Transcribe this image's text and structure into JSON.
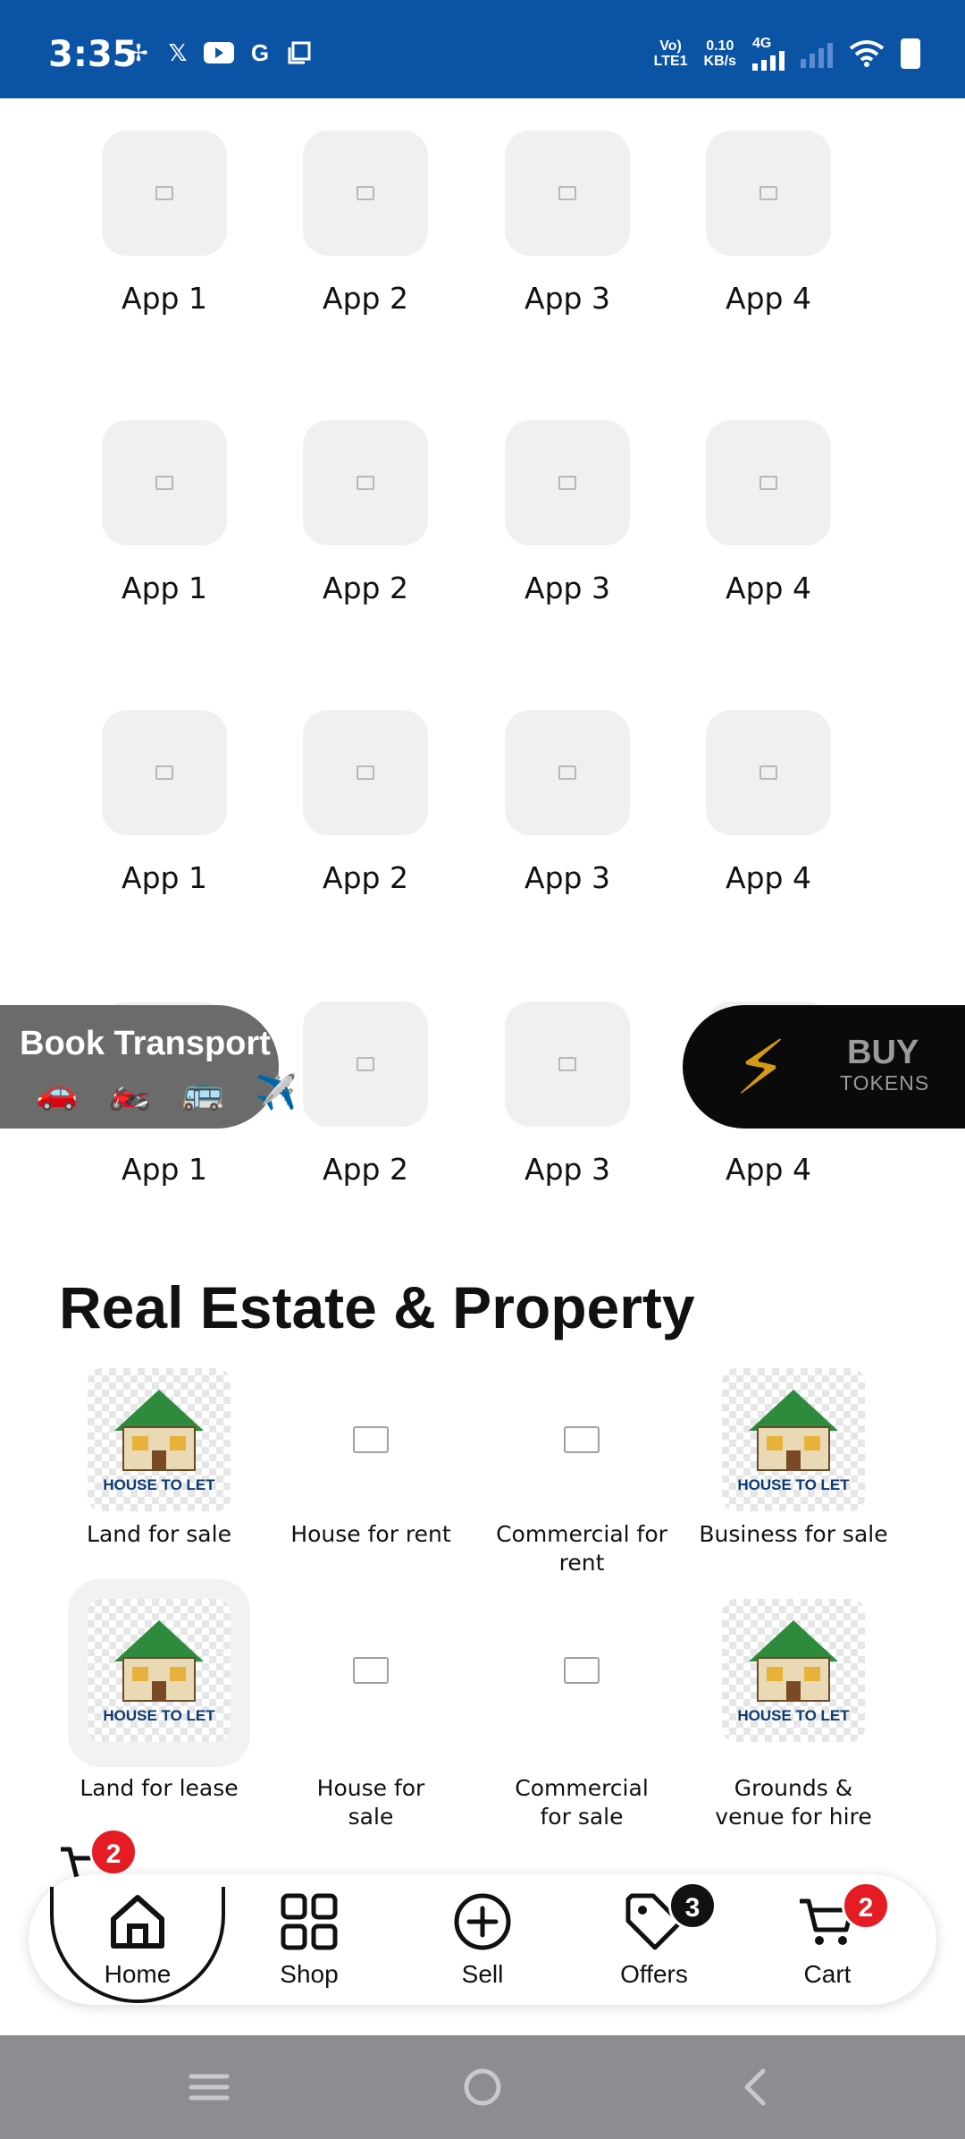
{
  "status_bar": {
    "time": "3:35",
    "app_icons": [
      "pinwheel-icon",
      "x-icon",
      "youtube-icon",
      "google-icon",
      "copy-icon"
    ],
    "network_label_top": "Vo)",
    "network_label_bottom": "LTE1",
    "data_speed": "0.10",
    "data_unit": "KB/s",
    "network_type": "4G"
  },
  "app_rows": [
    [
      "App 1",
      "App 2",
      "App 3",
      "App 4"
    ],
    [
      "App 1",
      "App 2",
      "App 3",
      "App 4"
    ],
    [
      "App 1",
      "App 2",
      "App 3",
      "App 4"
    ],
    [
      "App 1",
      "App 2",
      "App 3",
      "App 4"
    ]
  ],
  "transport": {
    "title": "Book Transport",
    "icons": "🚗 🏍️ 🚌 ✈️"
  },
  "tokens": {
    "line1": "BUY",
    "line2": "TOKENS",
    "icon": "lightning-icon",
    "icon_color": "#d39a14"
  },
  "real_estate": {
    "title": "Real Estate & Property",
    "house_sign_text": "HOUSE TO LET",
    "items": [
      {
        "label": "Land for sale",
        "icon": "house-to-let-icon"
      },
      {
        "label": "House for rent",
        "icon": "image-placeholder-icon"
      },
      {
        "label": "Commercial for rent",
        "icon": "image-placeholder-icon"
      },
      {
        "label": "Business for sale",
        "icon": "house-to-let-icon"
      },
      {
        "label": "Land for lease",
        "icon": "house-to-let-icon"
      },
      {
        "label": "House for sale",
        "icon": "image-placeholder-icon"
      },
      {
        "label": "Commercial for sale",
        "icon": "image-placeholder-icon"
      },
      {
        "label": "Grounds & venue for hire",
        "icon": "house-to-let-icon"
      }
    ]
  },
  "floating_cart": {
    "badge": "2"
  },
  "bottom_nav": {
    "items": [
      {
        "label": "Home",
        "icon": "home-icon",
        "active": true
      },
      {
        "label": "Shop",
        "icon": "grid-icon"
      },
      {
        "label": "Sell",
        "icon": "plus-circle-icon"
      },
      {
        "label": "Offers",
        "icon": "tag-icon",
        "badge": "3"
      },
      {
        "label": "Cart",
        "icon": "cart-icon",
        "badge": "2"
      }
    ]
  },
  "colors": {
    "status_bar": "#0b54a5",
    "badge_red": "#e51c23",
    "badge_black": "#111111",
    "tile_bg": "#f0f0f0",
    "system_nav": "#8c8d91"
  }
}
